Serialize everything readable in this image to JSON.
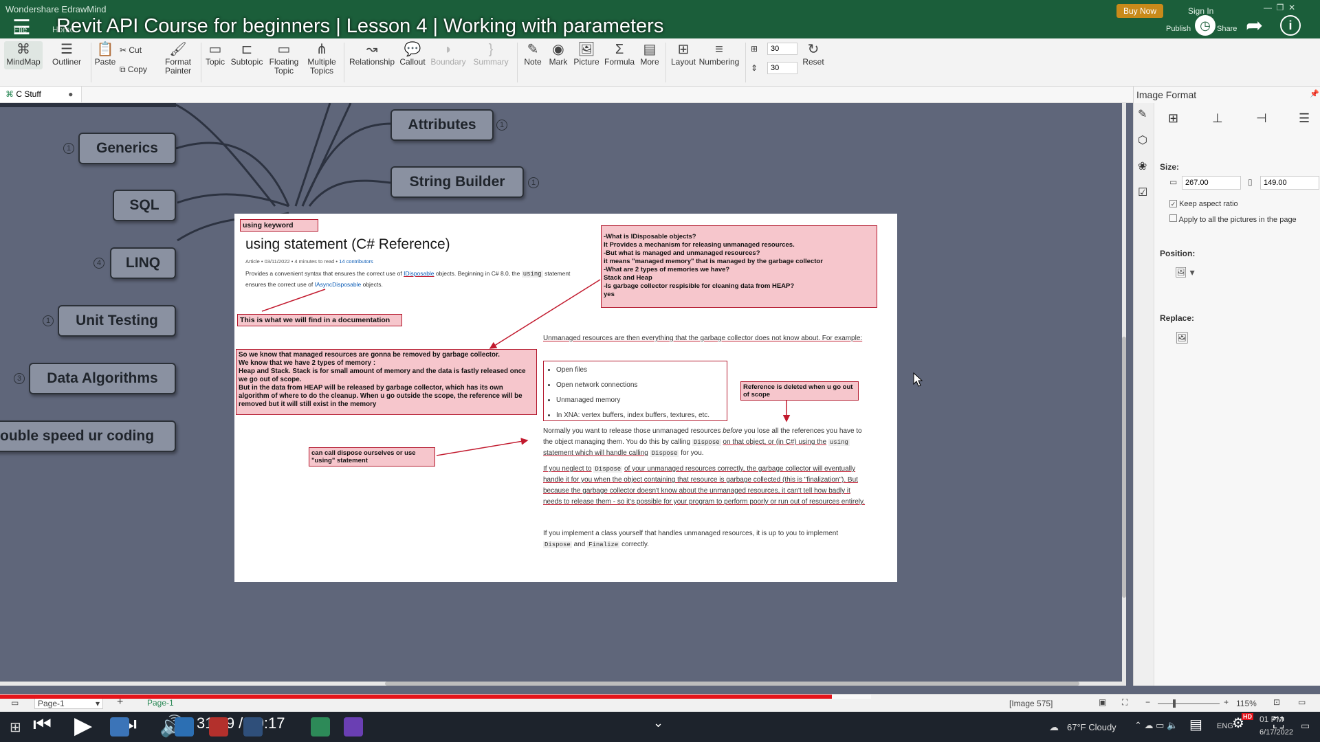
{
  "window": {
    "app_name": "Wondershare EdrawMind",
    "buy_now": "Buy Now",
    "sign_in": "Sign In",
    "publish": "Publish",
    "share": "Share"
  },
  "video": {
    "title": "Revit API Course for beginners | Lesson 4 | Working with parameters",
    "time": "31:49 / 50:17",
    "progress": 0.63,
    "buffered": 0.66
  },
  "menu": {
    "file": "File",
    "home": "Home"
  },
  "ribbon": {
    "mindmap": "MindMap",
    "outliner": "Outliner",
    "paste": "Paste",
    "cut": "Cut",
    "copy": "Copy",
    "format_painter": "Format Painter",
    "topic": "Topic",
    "subtopic": "Subtopic",
    "floating_topic": "Floating Topic",
    "multiple_topics": "Multiple Topics",
    "relationship": "Relationship",
    "callout": "Callout",
    "boundary": "Boundary",
    "summary": "Summary",
    "note": "Note",
    "mark": "Mark",
    "picture": "Picture",
    "formula": "Formula",
    "more": "More",
    "layout": "Layout",
    "numbering": "Numbering",
    "spacing_h": "30",
    "spacing_v": "30",
    "reset": "Reset"
  },
  "doc_tab": {
    "name": "C Stuff"
  },
  "topics": {
    "generics": "Generics",
    "sql": "SQL",
    "linq": "LINQ",
    "unit_testing": "Unit Testing",
    "data_algorithms": "Data Algorithms",
    "double_speed": "ouble speed ur coding",
    "attributes": "Attributes",
    "string_builder": "String Builder",
    "badge_generics": "1",
    "badge_linq": "4",
    "badge_unit": "1",
    "badge_data": "3",
    "badge_attr": "1",
    "badge_sb": "1"
  },
  "document": {
    "using_keyword": "using keyword",
    "heading": "using statement (C# Reference)",
    "meta_article": "Article • 03/11/2022 • 4 minutes to read •",
    "meta_contributors": "14 contributors",
    "intro_1": "Provides a convenient syntax that ensures the correct use of",
    "intro_idisposable": "IDisposable",
    "intro_2": "objects. Beginning in C# 8.0, the",
    "intro_using": "using",
    "intro_3": "statement ensures the correct use of",
    "intro_iasync": "IAsyncDisposable",
    "intro_4": "objects.",
    "note_doc": "This is what we will find in a documentation",
    "note_questions": [
      "-What is IDisposable objects?",
      "It Provides a mechanism for releasing unmanaged resources.",
      "-But what is managed and unmanaged resources?",
      "it means \"managed memory\" that is managed by the garbage collector",
      "-What are 2 types of memories we have?",
      "Stack and Heap",
      "-Is garbage collector respisible for cleaning data from HEAP?",
      "yes"
    ],
    "note_managed": [
      "So we know that managed resources are gonna be removed by garbage collector.",
      "We know that we have 2 types of memory :",
      "Heap and Stack. Stack is for small amount of memory and the data is fastly released once we go out of scope.",
      "But in the data from HEAP will be released by garbage collector, which has its own algorithm of where to do the cleanup. When u go outside the scope, the reference will be removed but it will still exist in the memory"
    ],
    "unmanaged_p": "Unmanaged resources are then everything that the garbage collector does not know about. For example:",
    "list": [
      "Open files",
      "Open network connections",
      "Unmanaged memory",
      "In XNA: vertex buffers, index buffers, textures, etc."
    ],
    "note_reference": "Reference is deleted when u go out of scope",
    "release_p1": "Normally you want to release those unmanaged resources",
    "release_before": "before",
    "release_p2": "you lose all the references you have to the object managing them. You do this by calling",
    "code_dispose": "Dispose",
    "release_p3": "on that object, or (in C#) using the",
    "code_using": "using",
    "release_p4": "statement which will handle calling",
    "release_p5": "for you.",
    "note_dispose": "can call dispose ourselves or use \"using\" statement",
    "neglect_1": "If you neglect to",
    "neglect_2": "of your unmanaged resources correctly, the garbage collector will eventually handle it for you when the object containing that resource is garbage collected (this is \"finalization\"). But because the garbage collector doesn't know about the unmanaged resources, it can't tell how badly it needs to release them - so it's possible for your program to perform poorly or run out of resources entirely.",
    "implement_1": "If you implement a class yourself that handles unmanaged resources, it is up to you to implement",
    "code_finalize": "Finalize",
    "implement_and": "and",
    "implement_2": "correctly."
  },
  "panel": {
    "title": "Image Format",
    "size_label": "Size:",
    "width": "267.00",
    "height": "149.00",
    "keep_aspect": "Keep aspect ratio",
    "apply_all": "Apply to all the pictures in the page",
    "position_label": "Position:",
    "replace_label": "Replace:"
  },
  "status": {
    "page_select": "Page-1",
    "page_tab": "Page-1",
    "image_info": "[Image 575]",
    "zoom": "115%"
  },
  "taskbar": {
    "weather": "67°F  Cloudy",
    "lang": "ENG",
    "time": "01 PM",
    "date": "6/17/2022"
  },
  "colors": {
    "title_green": "#1b5e3a",
    "note_bg": "#f6c6cc",
    "note_border": "#b3172c",
    "progress_red": "#e5141b"
  }
}
